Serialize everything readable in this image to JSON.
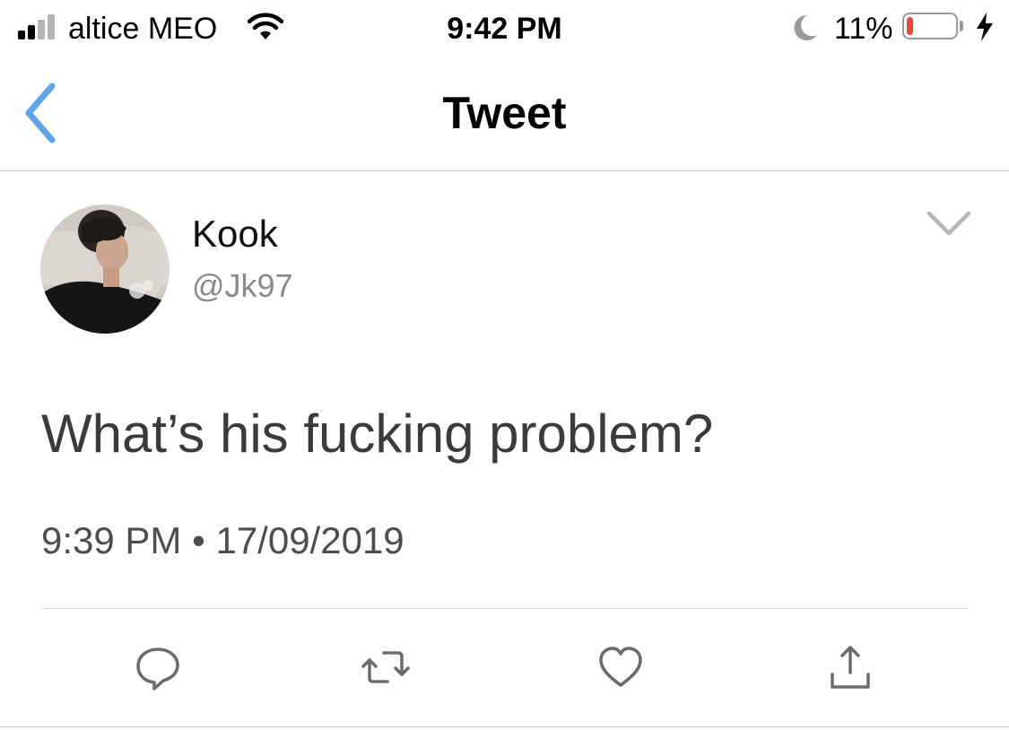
{
  "status_bar": {
    "carrier": "altice MEO",
    "time": "9:42 PM",
    "battery_percent": "11%",
    "battery_level": 0.11,
    "signal_bars_active": 2,
    "signal_bars_total": 4,
    "icons": [
      "signal-icon",
      "wifi-icon",
      "moon-icon",
      "battery-icon",
      "charging-bolt-icon"
    ],
    "colors": {
      "battery_low": "#e5473a",
      "icon_gray": "#9a9a9a"
    }
  },
  "nav": {
    "title": "Tweet",
    "back_icon": "chevron-left-icon",
    "accent_color": "#5fa3e8"
  },
  "tweet": {
    "author_name": "Kook",
    "author_handle": "@Jk97",
    "text": "What’s his fucking problem?",
    "meta": "9:39 PM • 17/09/2019",
    "more_icon": "chevron-down-icon"
  },
  "actions": [
    {
      "name": "reply-button",
      "icon": "reply-icon"
    },
    {
      "name": "retweet-button",
      "icon": "retweet-icon"
    },
    {
      "name": "like-button",
      "icon": "heart-icon"
    },
    {
      "name": "share-button",
      "icon": "share-icon"
    }
  ]
}
